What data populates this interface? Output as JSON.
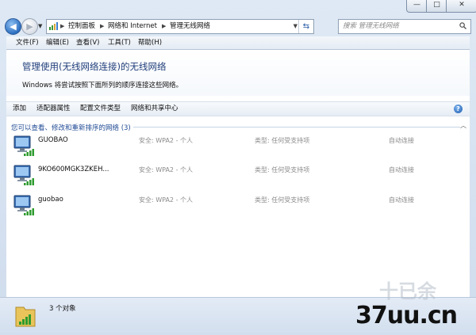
{
  "address": {
    "crumbs": [
      "控制面板",
      "网络和 Internet",
      "管理无线网络"
    ],
    "search_placeholder": "搜索 管理无线网络"
  },
  "window_buttons": {
    "minimize": "—",
    "maximize": "□",
    "close": "✕"
  },
  "menu": [
    "文件(F)",
    "编辑(E)",
    "查看(V)",
    "工具(T)",
    "帮助(H)"
  ],
  "header": {
    "title": "管理使用(无线网络连接)的无线网络",
    "description": "Windows 将尝试按照下面所列的顺序连接这些网络。"
  },
  "commands": [
    "添加",
    "适配器属性",
    "配置文件类型",
    "网络和共享中心"
  ],
  "group_label": "您可以查看、修改和重新排序的网络 (3)",
  "networks": [
    {
      "name": "GUOBAO",
      "security": "安全: WPA2 - 个人",
      "type": "类型: 任何受支持项",
      "mode": "自动连接"
    },
    {
      "name": "9KO600MGK3ZKEH...",
      "security": "安全: WPA2 - 个人",
      "type": "类型: 任何受支持项",
      "mode": "自动连接"
    },
    {
      "name": "guobao",
      "security": "安全: WPA2 - 个人",
      "type": "类型: 任何受支持项",
      "mode": "自动连接"
    }
  ],
  "status": {
    "count_text": "3 个对象"
  },
  "watermark": {
    "logo": "37uu.cn",
    "ghost": "十已余"
  }
}
